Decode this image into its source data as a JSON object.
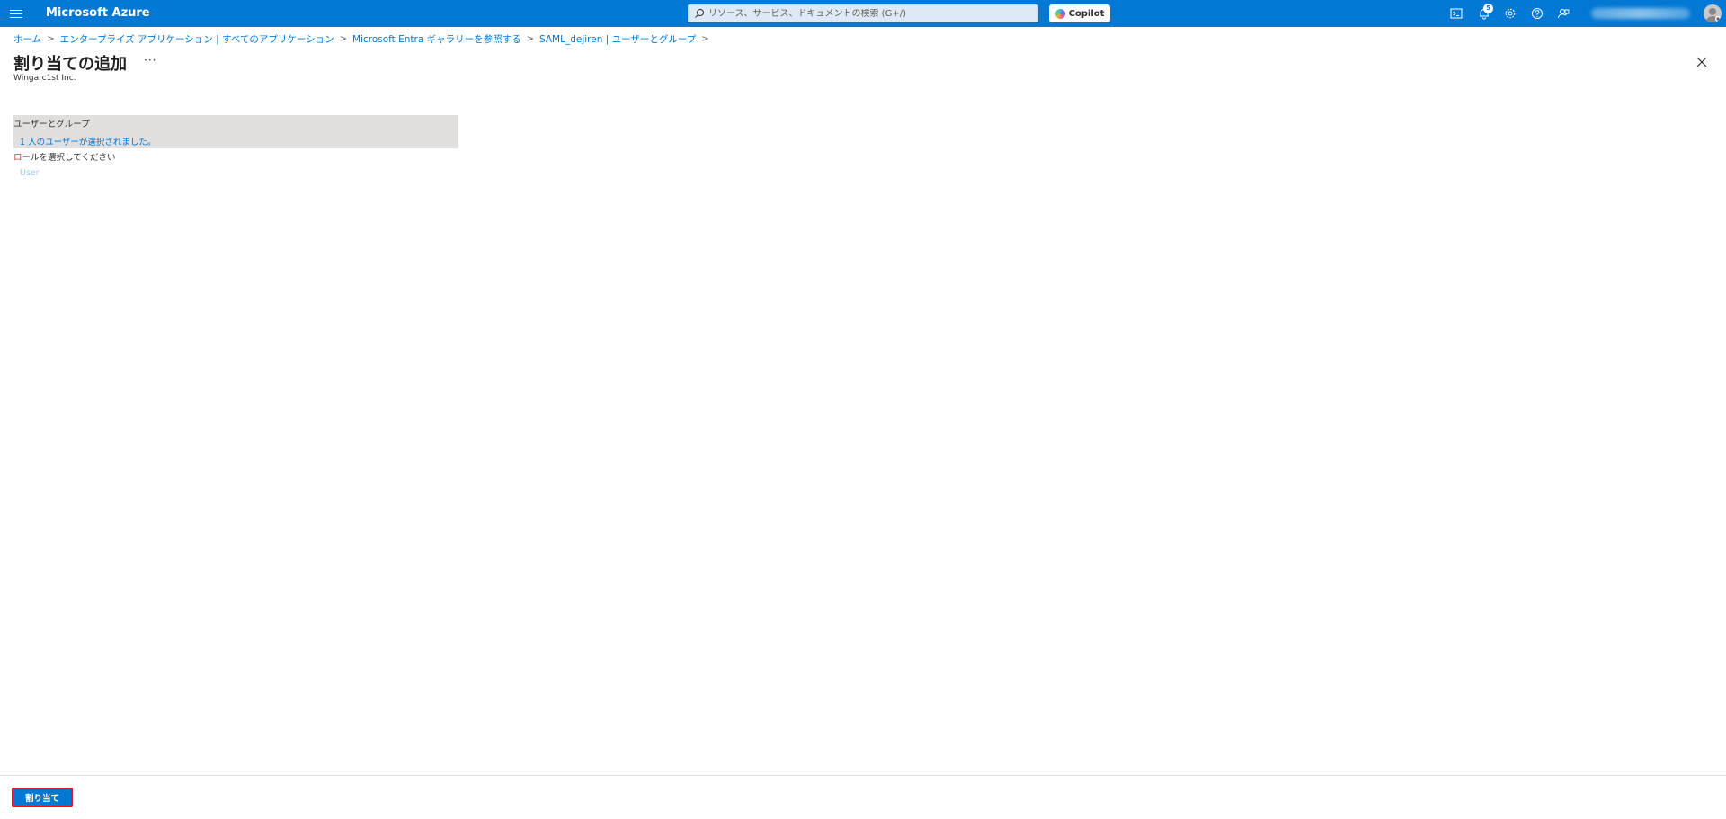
{
  "header": {
    "brand": "Microsoft Azure",
    "search_placeholder": "リソース、サービス、ドキュメントの検索 (G+/)",
    "copilot_label": "Copilot",
    "notification_count": "5"
  },
  "breadcrumb": [
    "ホーム",
    "エンタープライズ アプリケーション | すべてのアプリケーション",
    "Microsoft Entra ギャラリーを参照する",
    "SAML_dejiren | ユーザーとグループ"
  ],
  "page": {
    "title": "割り当ての追加",
    "more_label": "···",
    "subtitle": "Wingarc1st Inc."
  },
  "assignment": {
    "users_groups_label": "ユーザーとグループ",
    "users_selected_text": "1 人のユーザーが選択されました。",
    "role_label_first": "ロ",
    "role_label_rest": "ールを選択してください",
    "role_value": "User"
  },
  "footer": {
    "assign_button": "割り当て"
  },
  "colors": {
    "azure_blue": "#0078d4",
    "highlight_red": "#e81123"
  }
}
